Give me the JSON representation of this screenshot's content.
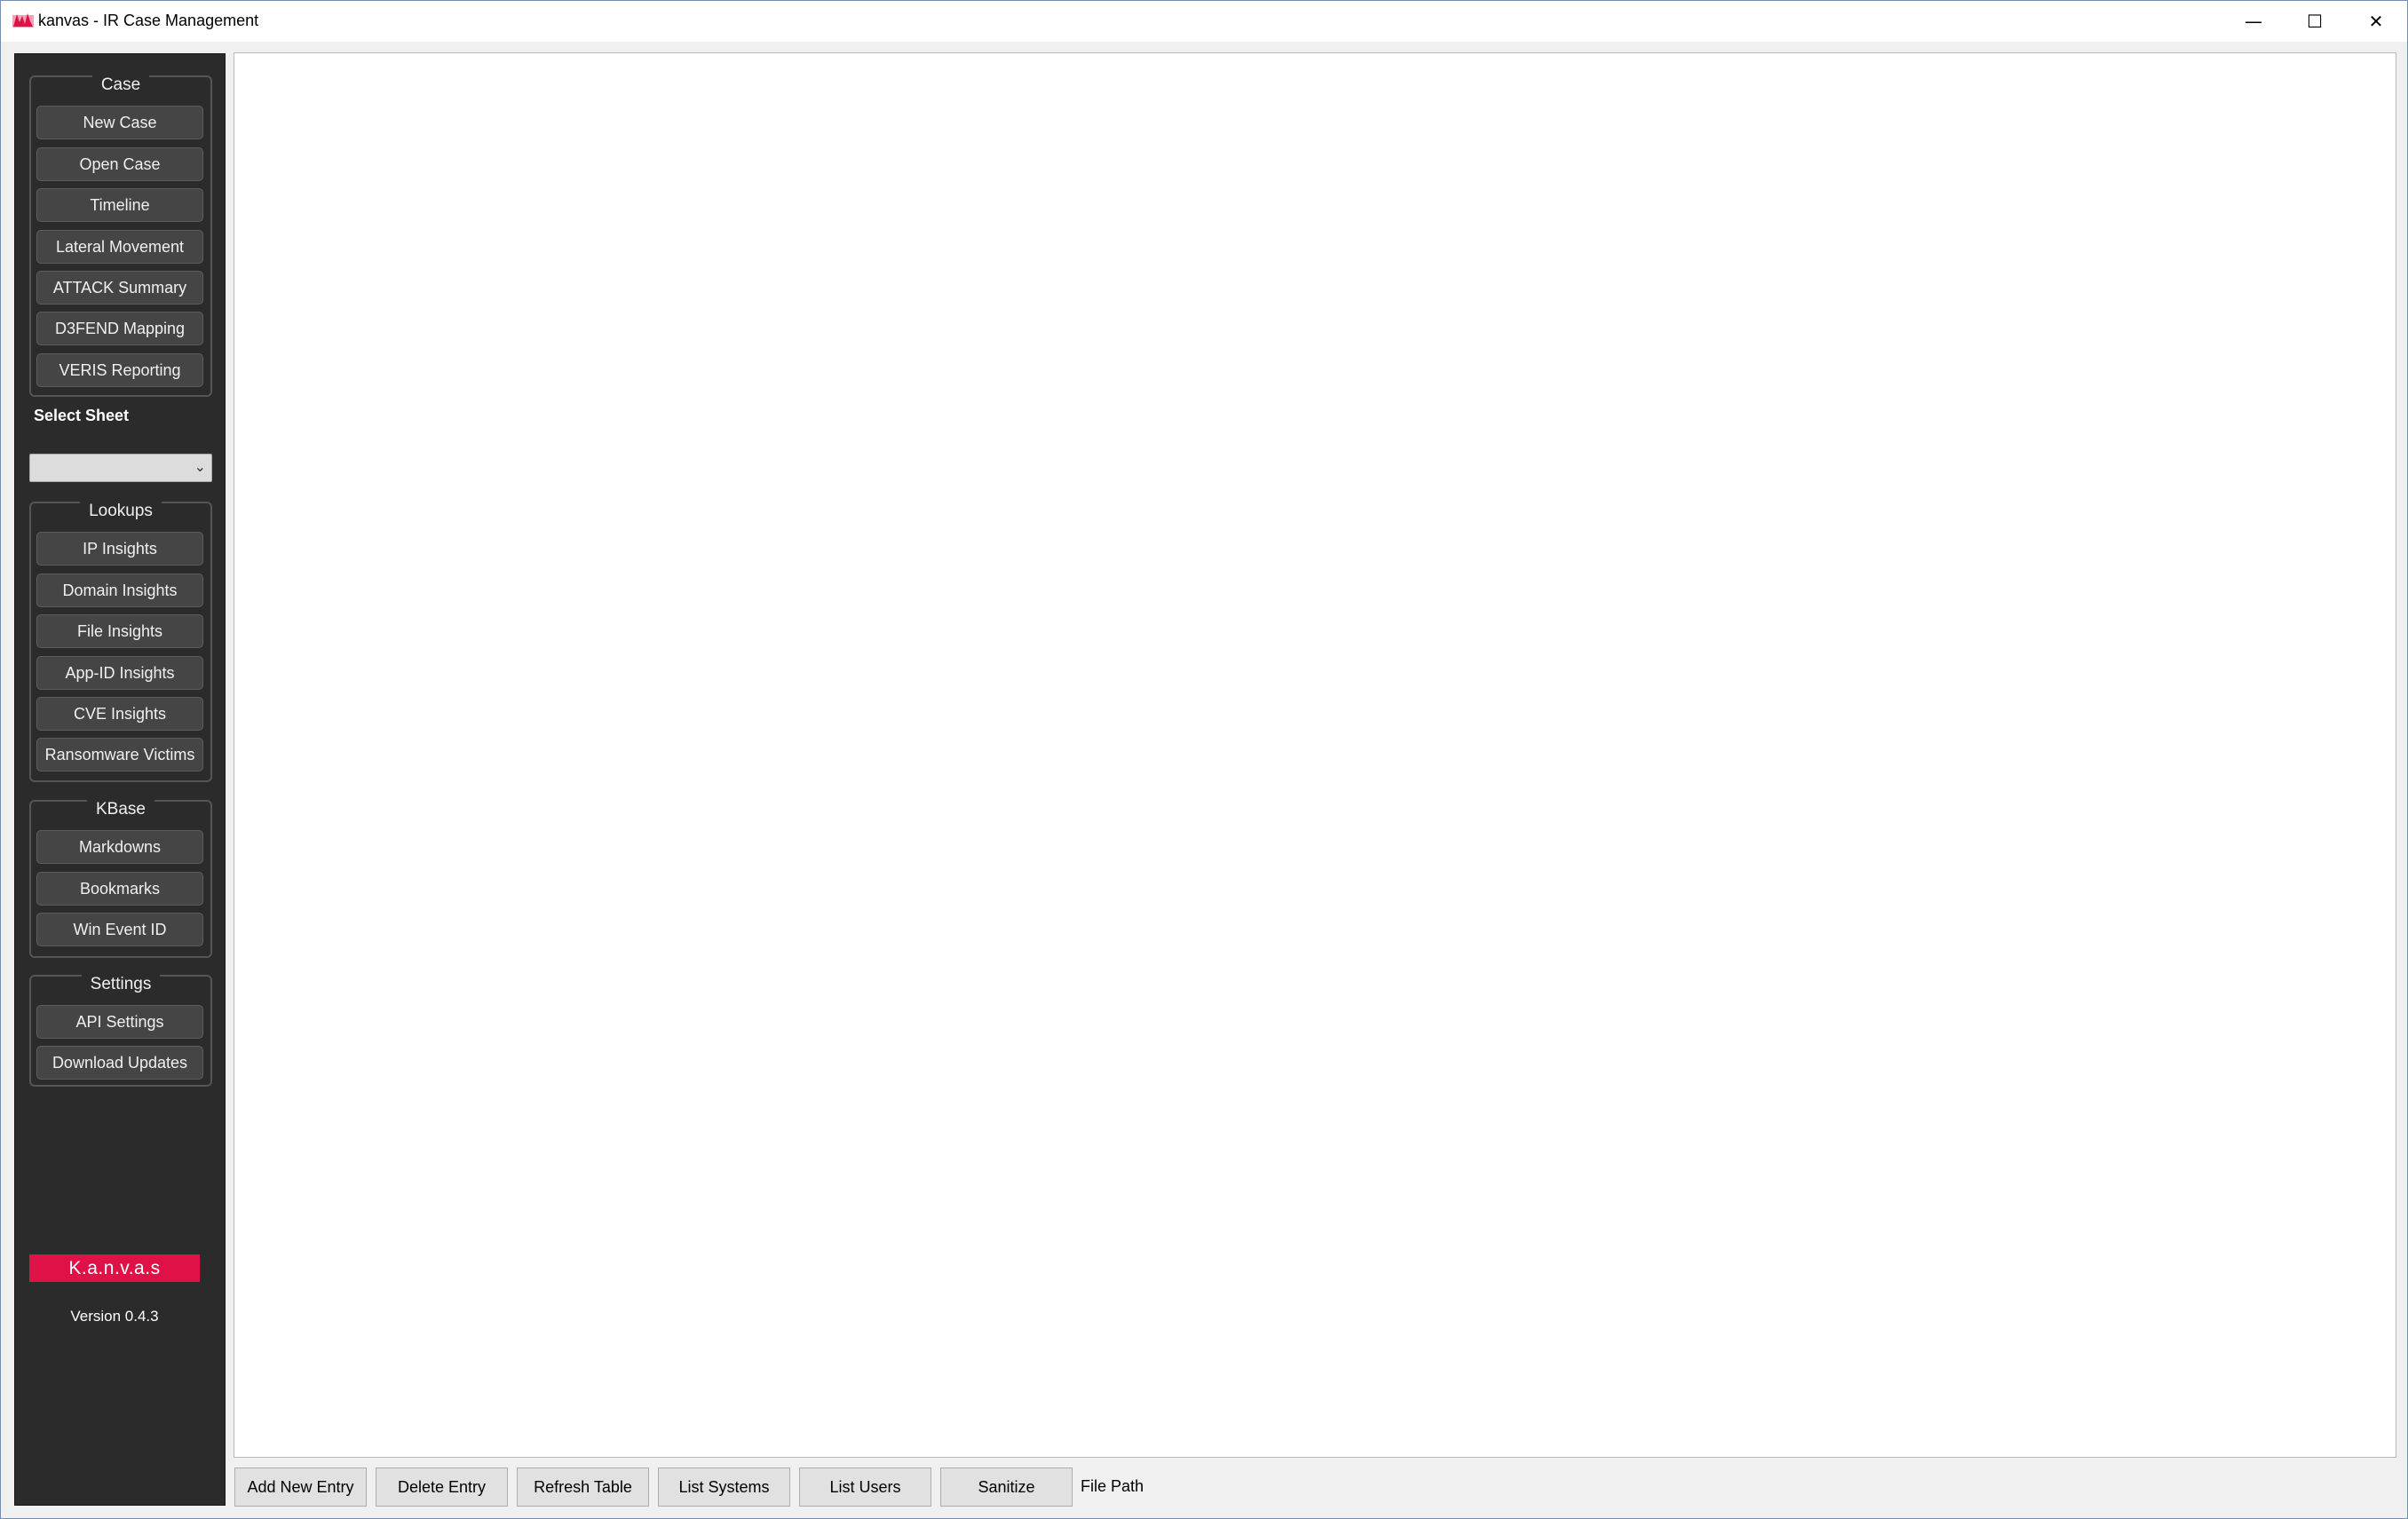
{
  "window": {
    "title": "kanvas - IR Case Management",
    "controls": {
      "minimize": "—",
      "maximize": "☐",
      "close": "✕"
    }
  },
  "sidebar": {
    "case_group": {
      "title": "Case",
      "buttons": [
        "New Case",
        "Open Case",
        "Timeline",
        "Lateral Movement",
        "ATTACK Summary",
        "D3FEND Mapping",
        "VERIS Reporting"
      ]
    },
    "select_sheet": {
      "label": "Select Sheet",
      "value": ""
    },
    "lookups_group": {
      "title": "Lookups",
      "buttons": [
        "IP Insights",
        "Domain Insights",
        "File Insights",
        "App-ID Insights",
        "CVE Insights",
        "Ransomware Victims"
      ]
    },
    "kbase_group": {
      "title": "KBase",
      "buttons": [
        "Markdowns",
        "Bookmarks",
        "Win Event ID"
      ]
    },
    "settings_group": {
      "title": "Settings",
      "buttons": [
        "API Settings",
        "Download Updates"
      ]
    },
    "brand": "K.a.n.v.a.s",
    "version": "Version 0.4.3"
  },
  "toolbar": {
    "buttons": [
      "Add New Entry",
      "Delete Entry",
      "Refresh Table",
      "List Systems",
      "List Users",
      "Sanitize"
    ],
    "file_path_label": "File Path"
  },
  "colors": {
    "sidebar_bg": "#2b2b2b",
    "brand_bg": "#e01147",
    "window_bg": "#f0f0f0"
  }
}
